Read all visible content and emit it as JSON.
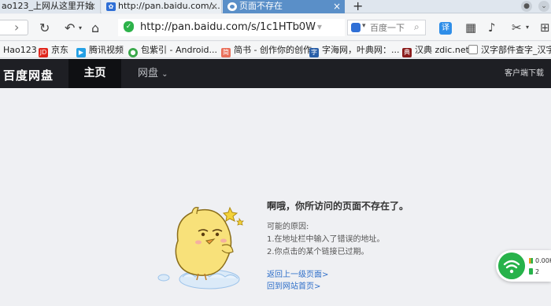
{
  "browser": {
    "tabs": [
      {
        "title": "ao123_上网从这里开始",
        "close": "×"
      },
      {
        "title": "http://pan.baidu.com/...",
        "close": "×"
      },
      {
        "title": "页面不存在",
        "close": "×",
        "active": true
      }
    ],
    "new_tab": "+",
    "address": {
      "url": "http://pan.baidu.com/s/1c1HTb0W"
    },
    "search": {
      "placeholder": "百度一下"
    },
    "translate_label": "译",
    "bookmarks": [
      {
        "label": "Hao123",
        "icon": "none"
      },
      {
        "label": "京东",
        "icon": "jd-icon",
        "badge": "JD",
        "color": "#e1251b"
      },
      {
        "label": "腾讯视频",
        "icon": "tencent-video-icon",
        "color": "#24a0e5"
      },
      {
        "label": "包紫引 - Android...",
        "icon": "android-icon",
        "color": "#3aa84a"
      },
      {
        "label": "简书 - 创作你的创作",
        "icon": "jianshu-icon",
        "badge": "简",
        "color": "#ea6f5a"
      },
      {
        "label": "字海网，叶典网：...",
        "icon": "zihai-icon",
        "color": "#2a5fa8"
      },
      {
        "label": "汉典 zdic.net",
        "icon": "zdic-icon",
        "color": "#8b1c1c"
      },
      {
        "label": "汉字部件查字_汉字...",
        "icon": "page-icon",
        "color": "#888888"
      }
    ]
  },
  "site": {
    "logo": "百度网盘",
    "nav_home": "主页",
    "nav_pan": "网盘",
    "nav_pan_caret": "⌄",
    "client_download": "客户端下载"
  },
  "error": {
    "title": "啊哦，你所访问的页面不存在了。",
    "reasons_heading": "可能的原因:",
    "reason_1": "1.在地址栏中输入了错误的地址。",
    "reason_2": "2.你点击的某个链接已过期。",
    "link_back": "返回上一级页面>",
    "link_home": "回到网站首页>"
  },
  "widget": {
    "speed": "0.00K",
    "count": "2"
  },
  "colors": {
    "header_bg": "#1e1f24",
    "active_tab": "#5a8fc8",
    "link": "#2f6fc9",
    "page_bg": "#eff0f3"
  }
}
